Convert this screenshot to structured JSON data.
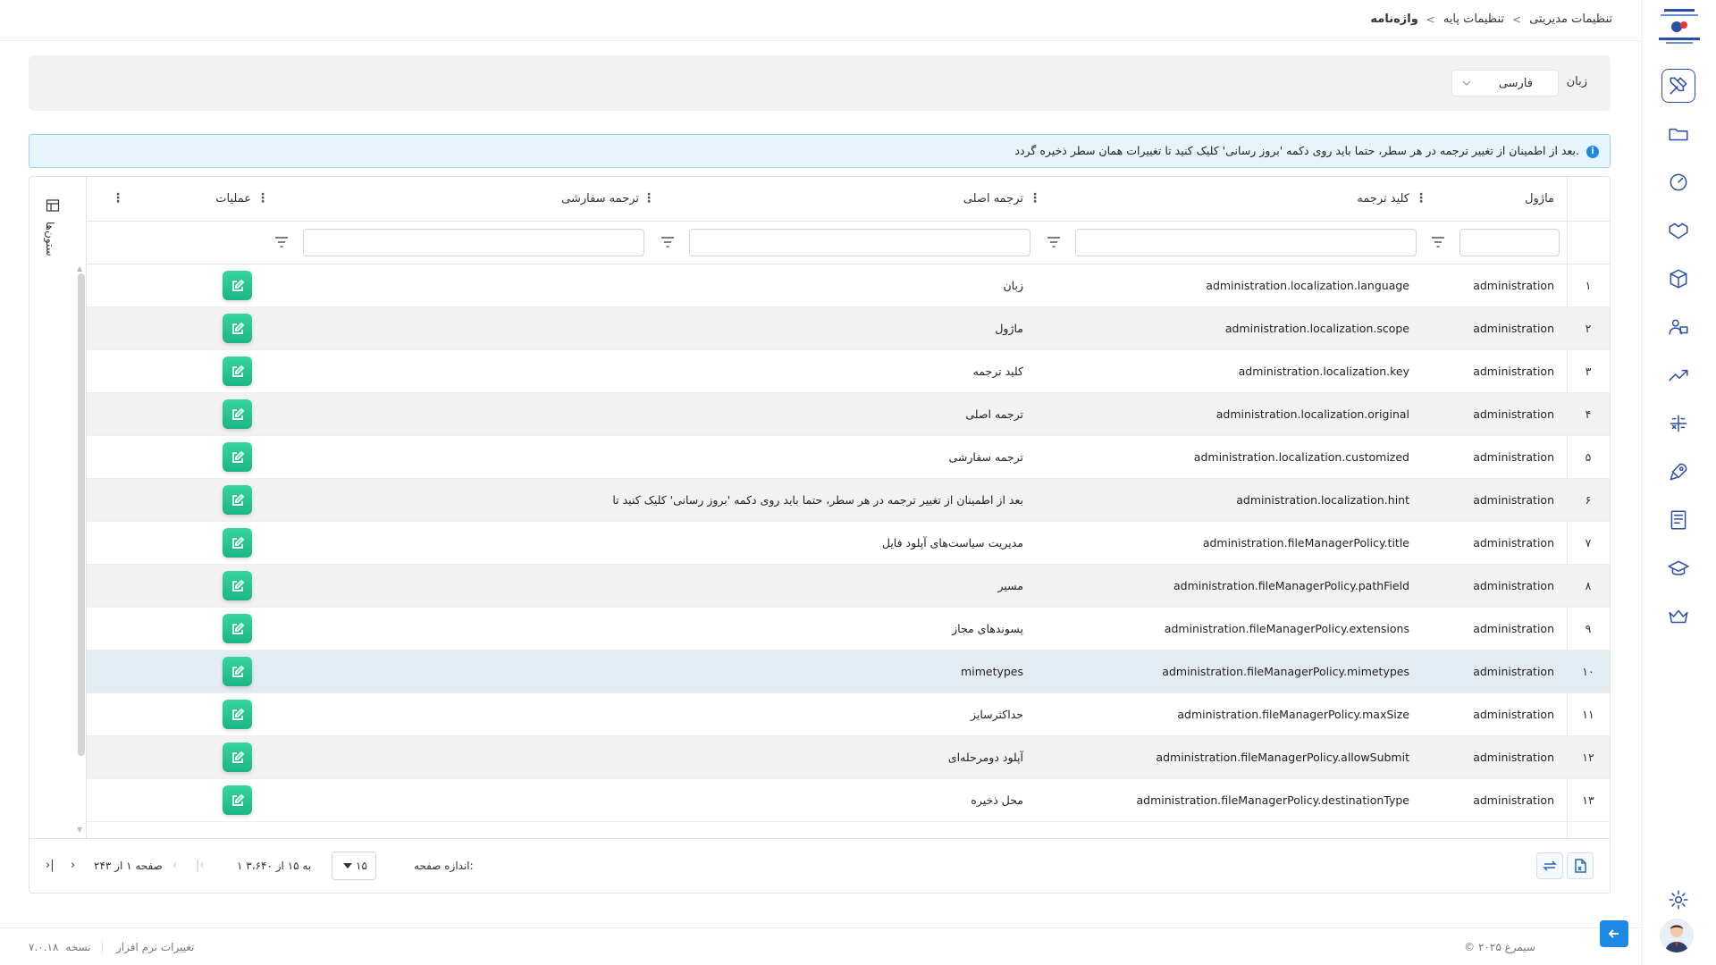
{
  "breadcrumb": {
    "items": [
      "تنظیمات مدیریتی",
      "تنظیمات پایه",
      "واژه‌نامه"
    ]
  },
  "language_filter": {
    "label": "زبان",
    "value": "فارسی"
  },
  "hint": {
    "text": "بعد از اطمینان از تغییر ترجمه در هر سطر، حتما باید روی دکمه 'بروز رسانی' کلیک کنید تا تغییرات همان سطر ذخیره گردد."
  },
  "grid": {
    "side_panel_label": "ستون‌ها",
    "columns": {
      "module": "ماژول",
      "key": "کلید ترجمه",
      "original": "ترجمه اصلی",
      "custom": "ترجمه سفارشی",
      "actions": "عملیات"
    },
    "rows": [
      {
        "num": "۱",
        "module": "administration",
        "key": "administration.localization.language",
        "original": "زبان"
      },
      {
        "num": "۲",
        "module": "administration",
        "key": "administration.localization.scope",
        "original": "ماژول"
      },
      {
        "num": "۳",
        "module": "administration",
        "key": "administration.localization.key",
        "original": "کلید ترجمه"
      },
      {
        "num": "۴",
        "module": "administration",
        "key": "administration.localization.original",
        "original": "ترجمه اصلی"
      },
      {
        "num": "۵",
        "module": "administration",
        "key": "administration.localization.customized",
        "original": "ترجمه سفارشی"
      },
      {
        "num": "۶",
        "module": "administration",
        "key": "administration.localization.hint",
        "original": "بعد از اطمینان از تغییر ترجمه در هر سطر، حتما باید روی دکمه 'بروز رسانی' کلیک کنید تا"
      },
      {
        "num": "۷",
        "module": "administration",
        "key": "administration.fileManagerPolicy.title",
        "original": "مدیریت سیاست‌های آپلود فایل"
      },
      {
        "num": "۸",
        "module": "administration",
        "key": "administration.fileManagerPolicy.pathField",
        "original": "مسیر"
      },
      {
        "num": "۹",
        "module": "administration",
        "key": "administration.fileManagerPolicy.extensions",
        "original": "پسوندهای مجاز"
      },
      {
        "num": "۱۰",
        "module": "administration",
        "key": "administration.fileManagerPolicy.mimetypes",
        "original": "mimetypes"
      },
      {
        "num": "۱۱",
        "module": "administration",
        "key": "administration.fileManagerPolicy.maxSize",
        "original": "حداکثرسایز"
      },
      {
        "num": "۱۲",
        "module": "administration",
        "key": "administration.fileManagerPolicy.allowSubmit",
        "original": "آپلود دومرحله‌ای"
      },
      {
        "num": "۱۳",
        "module": "administration",
        "key": "administration.fileManagerPolicy.destinationType",
        "original": "محل ذخیره"
      }
    ],
    "selected_row": "۱۰"
  },
  "pager": {
    "page_size_label": "اندازه صفحه:",
    "page_size": "۱۵",
    "range": "۱ به ۱۵ از ۳،۶۴۰",
    "page_info": "صفحه ۱ از ۲۴۳"
  },
  "footer": {
    "copyright": "© ۲۰۲۵ سیمرغ",
    "version_label": "نسخه",
    "version": "۷.۰.۱۸",
    "changes": "تغییرات نرم افزار"
  },
  "sidebar": {
    "icons": [
      "tools-icon",
      "folder-icon",
      "dashboard-gauge-icon",
      "handshake-icon",
      "boxes-icon",
      "users-icon",
      "growth-chart-icon",
      "calculator-icon",
      "rocket-icon",
      "book-icon",
      "graduation-cap-icon",
      "crown-icon",
      "settings-gear-icon"
    ]
  },
  "colors": {
    "accent": "#2b4ea8",
    "edit_button": "#1db584",
    "hint_bg": "#e6f4fb",
    "selected_row": "#e3ebf3"
  }
}
